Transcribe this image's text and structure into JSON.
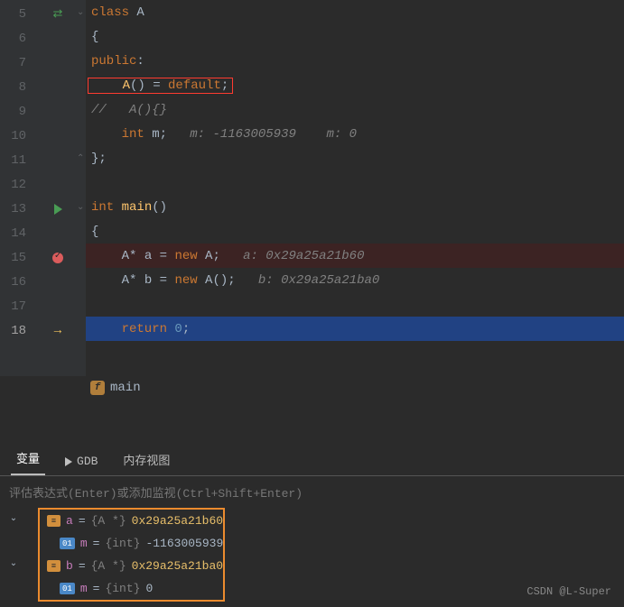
{
  "code": {
    "lines": [
      {
        "n": 5,
        "content": [
          {
            "t": "class ",
            "c": "kw"
          },
          {
            "t": "A",
            "c": "cls"
          }
        ]
      },
      {
        "n": 6,
        "content": [
          {
            "t": "{",
            "c": "pn"
          }
        ]
      },
      {
        "n": 7,
        "content": [
          {
            "t": "public",
            "c": "kw"
          },
          {
            "t": ":",
            "c": "pn"
          }
        ]
      },
      {
        "n": 8,
        "boxed": true,
        "content": [
          {
            "t": "A",
            "c": "fn"
          },
          {
            "t": "() = ",
            "c": "pn"
          },
          {
            "t": "default",
            "c": "kw"
          },
          {
            "t": ";",
            "c": "pn"
          }
        ]
      },
      {
        "n": 9,
        "content": [
          {
            "t": "//   A(){}",
            "c": "cm"
          }
        ]
      },
      {
        "n": 10,
        "content": [
          {
            "t": "    int ",
            "c": "kw"
          },
          {
            "t": "m",
            "c": "pn"
          },
          {
            "t": ";   ",
            "c": "pn"
          },
          {
            "t": "m: -1163005939    m: 0",
            "c": "cm"
          }
        ]
      },
      {
        "n": 11,
        "content": [
          {
            "t": "};",
            "c": "pn"
          }
        ]
      },
      {
        "n": 12,
        "content": []
      },
      {
        "n": 13,
        "content": [
          {
            "t": "int ",
            "c": "kw"
          },
          {
            "t": "main",
            "c": "fn"
          },
          {
            "t": "()",
            "c": "pn"
          }
        ]
      },
      {
        "n": 14,
        "content": [
          {
            "t": "{",
            "c": "pn"
          }
        ]
      },
      {
        "n": 15,
        "hl": "red",
        "content": [
          {
            "t": "    A",
            "c": "pn"
          },
          {
            "t": "* ",
            "c": "op"
          },
          {
            "t": "a = ",
            "c": "pn"
          },
          {
            "t": "new ",
            "c": "kw"
          },
          {
            "t": "A;   ",
            "c": "pn"
          },
          {
            "t": "a: 0x29a25a21b60",
            "c": "cm"
          }
        ]
      },
      {
        "n": 16,
        "content": [
          {
            "t": "    A",
            "c": "pn"
          },
          {
            "t": "* ",
            "c": "op"
          },
          {
            "t": "b = ",
            "c": "pn"
          },
          {
            "t": "new ",
            "c": "kw"
          },
          {
            "t": "A();   ",
            "c": "pn"
          },
          {
            "t": "b: 0x29a25a21ba0",
            "c": "cm"
          }
        ]
      },
      {
        "n": 17,
        "content": []
      },
      {
        "n": 18,
        "hl": "blue",
        "content": [
          {
            "t": "    return ",
            "c": "kw"
          },
          {
            "t": "0",
            "c": "num"
          },
          {
            "t": ";",
            "c": "pn"
          }
        ]
      }
    ],
    "indents": {
      "5": 0,
      "6": 0,
      "7": 0,
      "8": 1,
      "9": 0,
      "10": 0,
      "11": 0,
      "12": 0,
      "13": 0,
      "14": 0,
      "15": 0,
      "16": 0,
      "17": 0,
      "18": 0
    }
  },
  "gutter": {
    "5": {
      "icon": "swap",
      "fold": true
    },
    "6": {},
    "7": {},
    "8": {},
    "9": {},
    "10": {},
    "11": {
      "foldEnd": true
    },
    "12": {},
    "13": {
      "icon": "run",
      "fold": true
    },
    "14": {},
    "15": {
      "icon": "bp"
    },
    "16": {},
    "17": {},
    "18": {
      "icon": "arrow",
      "current": true
    }
  },
  "breadcrumb": {
    "fn": "main"
  },
  "tabs": {
    "variables": "变量",
    "gdb": "GDB",
    "memory": "内存视图"
  },
  "eval_hint": "评估表达式(Enter)或添加监视(Ctrl+Shift+Enter)",
  "vars": [
    {
      "name": "a",
      "type": "{A *}",
      "value": "0x29a25a21b60",
      "children": [
        {
          "name": "m",
          "type": "{int}",
          "value": "-1163005939"
        }
      ]
    },
    {
      "name": "b",
      "type": "{A *}",
      "value": "0x29a25a21ba0",
      "children": [
        {
          "name": "m",
          "type": "{int}",
          "value": "0"
        }
      ]
    }
  ],
  "watermark": "CSDN @L-Super"
}
